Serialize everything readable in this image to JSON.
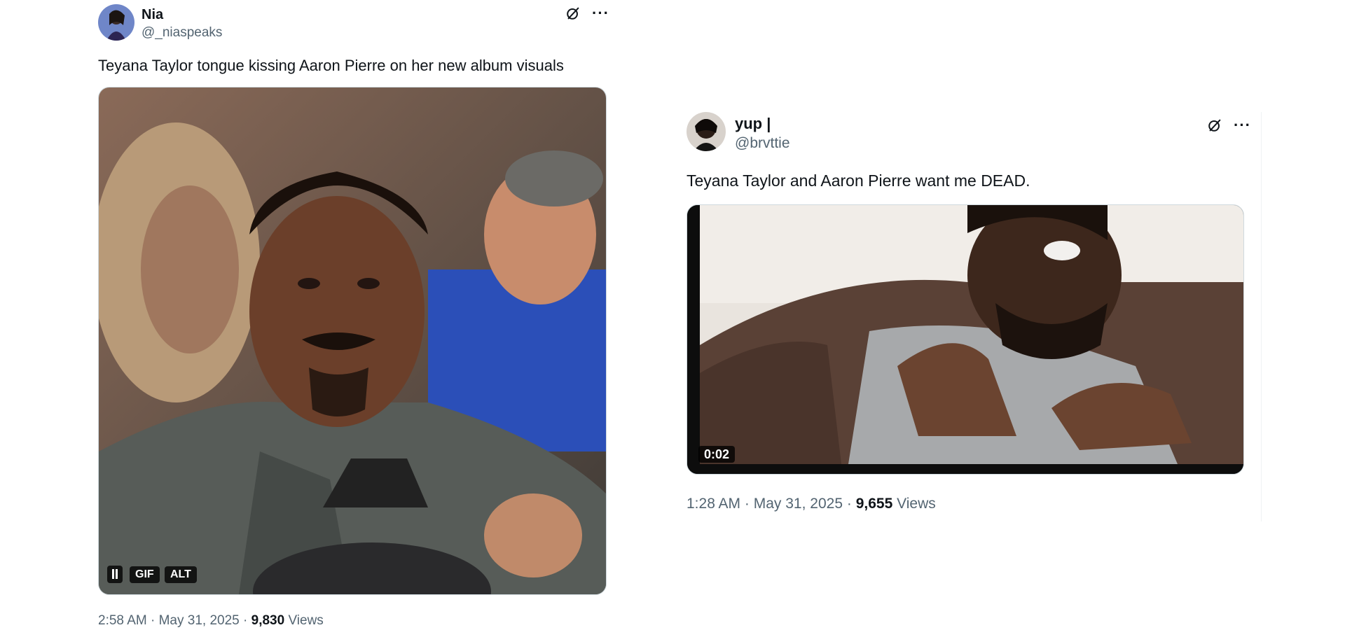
{
  "tweets": [
    {
      "author": {
        "name": "Nia",
        "handle": "@_niaspeaks"
      },
      "text": "Teyana Taylor tongue kissing Aaron Pierre on her new album visuals",
      "media": {
        "type": "gif",
        "pause_icon": "pause-icon",
        "gif_label": "GIF",
        "alt_label": "ALT"
      },
      "time": "2:58 AM",
      "date": "May 31, 2025",
      "views_count": "9,830",
      "views_label": "Views",
      "sep": "·"
    },
    {
      "author": {
        "name": "yup |",
        "handle": "@brvttie"
      },
      "text": "Teyana Taylor and Aaron Pierre want me DEAD.",
      "media": {
        "type": "video",
        "duration": "0:02"
      },
      "time": "1:28 AM",
      "date": "May 31, 2025",
      "views_count": "9,655",
      "views_label": "Views",
      "sep": "·"
    }
  ],
  "icons": {
    "grok": "grok-icon",
    "more": "more-icon"
  },
  "colors": {
    "text": "#0f1419",
    "secondary": "#536471",
    "border": "#cfd9de"
  }
}
